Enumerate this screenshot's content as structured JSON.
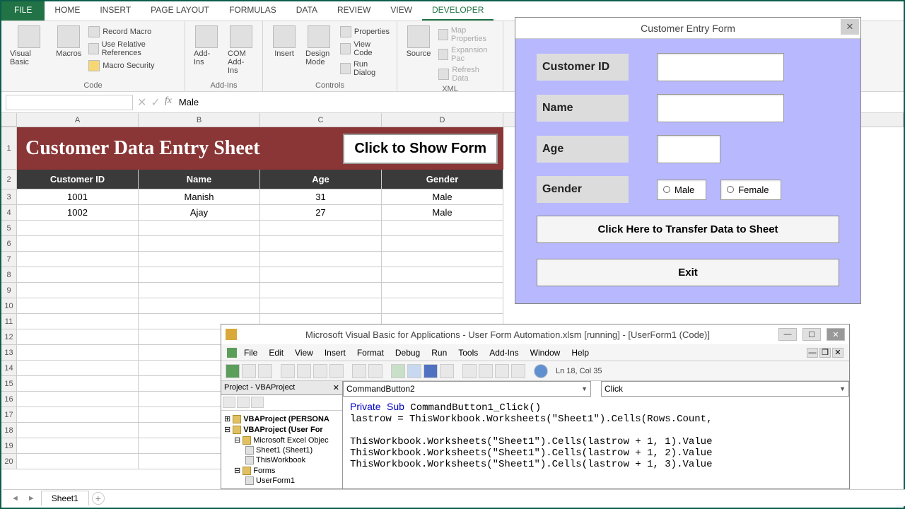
{
  "tabs": {
    "file": "FILE",
    "items": [
      "HOME",
      "INSERT",
      "PAGE LAYOUT",
      "FORMULAS",
      "DATA",
      "REVIEW",
      "VIEW",
      "DEVELOPER"
    ],
    "active": "DEVELOPER"
  },
  "ribbon": {
    "code": {
      "label": "Code",
      "visual_basic": "Visual Basic",
      "macros": "Macros",
      "record": "Record Macro",
      "relative": "Use Relative References",
      "security": "Macro Security"
    },
    "addins": {
      "label": "Add-Ins",
      "addins": "Add-Ins",
      "com": "COM Add-Ins"
    },
    "controls": {
      "label": "Controls",
      "insert": "Insert",
      "design": "Design Mode",
      "properties": "Properties",
      "view_code": "View Code",
      "run_dialog": "Run Dialog"
    },
    "xml": {
      "label": "XML",
      "source": "Source",
      "map": "Map Properties",
      "expansion": "Expansion Pac",
      "refresh": "Refresh Data"
    }
  },
  "formula_bar": {
    "name_box": "",
    "value": "Male"
  },
  "columns": [
    "A",
    "B",
    "C",
    "D"
  ],
  "row_numbers": [
    "1",
    "2",
    "3",
    "4",
    "5",
    "6",
    "7",
    "8",
    "9",
    "10",
    "11",
    "12",
    "13",
    "14",
    "15",
    "16",
    "17",
    "18",
    "19",
    "20"
  ],
  "sheet": {
    "title": "Customer Data Entry Sheet",
    "show_form_btn": "Click to Show Form",
    "headers": [
      "Customer ID",
      "Name",
      "Age",
      "Gender"
    ],
    "rows": [
      [
        "1001",
        "Manish",
        "31",
        "Male"
      ],
      [
        "1002",
        "Ajay",
        "27",
        "Male"
      ]
    ]
  },
  "sheet_tab": {
    "name": "Sheet1"
  },
  "userform": {
    "title": "Customer Entry Form",
    "labels": {
      "customer_id": "Customer ID",
      "name": "Name",
      "age": "Age",
      "gender": "Gender"
    },
    "radio": {
      "male": "Male",
      "female": "Female"
    },
    "transfer_btn": "Click Here to Transfer Data to Sheet",
    "exit_btn": "Exit"
  },
  "vba": {
    "title": "Microsoft Visual Basic for Applications - User Form Automation.xlsm [running] - [UserForm1 (Code)]",
    "menu": [
      "File",
      "Edit",
      "View",
      "Insert",
      "Format",
      "Debug",
      "Run",
      "Tools",
      "Add-Ins",
      "Window",
      "Help"
    ],
    "status": "Ln 18, Col 35",
    "project_title": "Project - VBAProject",
    "tree": {
      "p1": "VBAProject (PERSONA",
      "p2": "VBAProject (User For",
      "folder1": "Microsoft Excel Objec",
      "sheet1": "Sheet1 (Sheet1)",
      "thiswb": "ThisWorkbook",
      "forms": "Forms",
      "uf1": "UserForm1"
    },
    "dd_left": "CommandButton2",
    "dd_right": "Click",
    "code_lines": [
      "Private Sub CommandButton1_Click()",
      "lastrow = ThisWorkbook.Worksheets(\"Sheet1\").Cells(Rows.Count,",
      "",
      "ThisWorkbook.Worksheets(\"Sheet1\").Cells(lastrow + 1, 1).Value",
      "ThisWorkbook.Worksheets(\"Sheet1\").Cells(lastrow + 1, 2).Value",
      "ThisWorkbook.Worksheets(\"Sheet1\").Cells(lastrow + 1, 3).Value"
    ]
  }
}
